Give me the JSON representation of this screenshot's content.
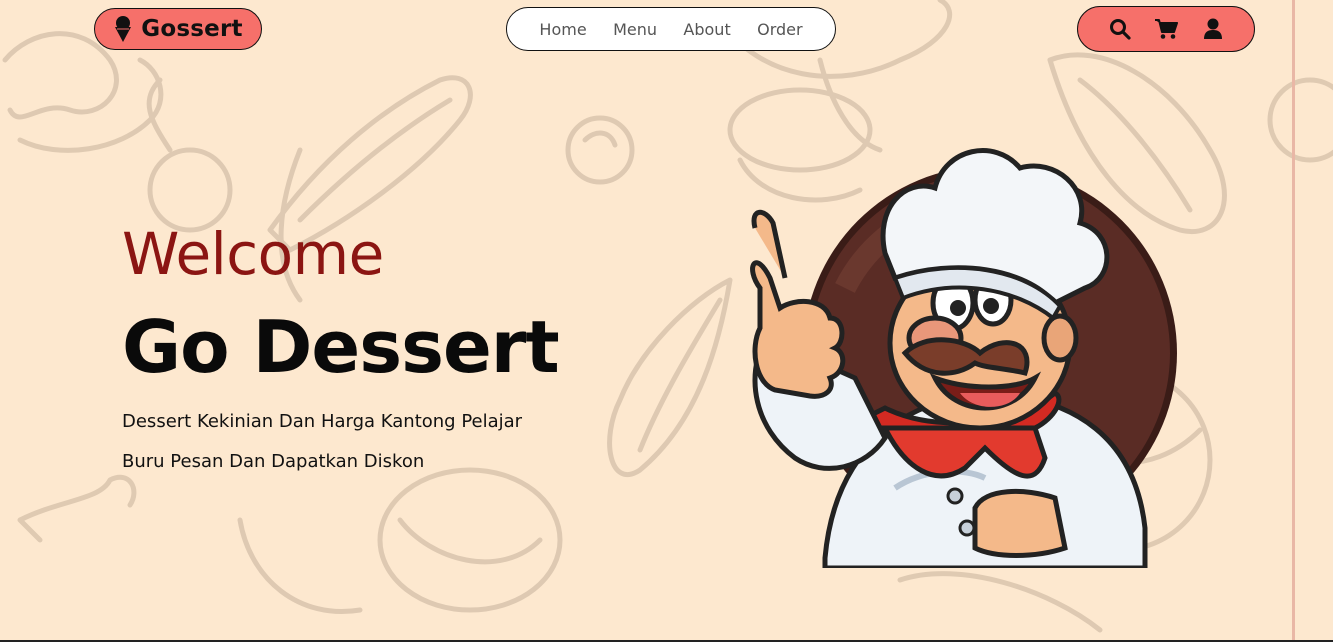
{
  "brand": {
    "name": "Gossert",
    "icon": "ice-cream-icon"
  },
  "nav": {
    "items": [
      {
        "label": "Home"
      },
      {
        "label": "Menu"
      },
      {
        "label": "About"
      },
      {
        "label": "Order"
      }
    ]
  },
  "actions": {
    "icons": [
      "search-icon",
      "cart-icon",
      "user-icon"
    ]
  },
  "hero": {
    "welcome": "Welcome",
    "title": "Go Dessert",
    "tagline_1": "Dessert Kekinian Dan Harga Kantong Pelajar",
    "tagline_2": "Buru Pesan Dan Dapatkan Diskon"
  },
  "colors": {
    "background": "#fde8cf",
    "accent": "#f6706a",
    "welcome_text": "#8b1512",
    "doodle_stroke": "#d9c4ad"
  },
  "illustration": {
    "subject": "chef-mascot-thumbs-up"
  }
}
